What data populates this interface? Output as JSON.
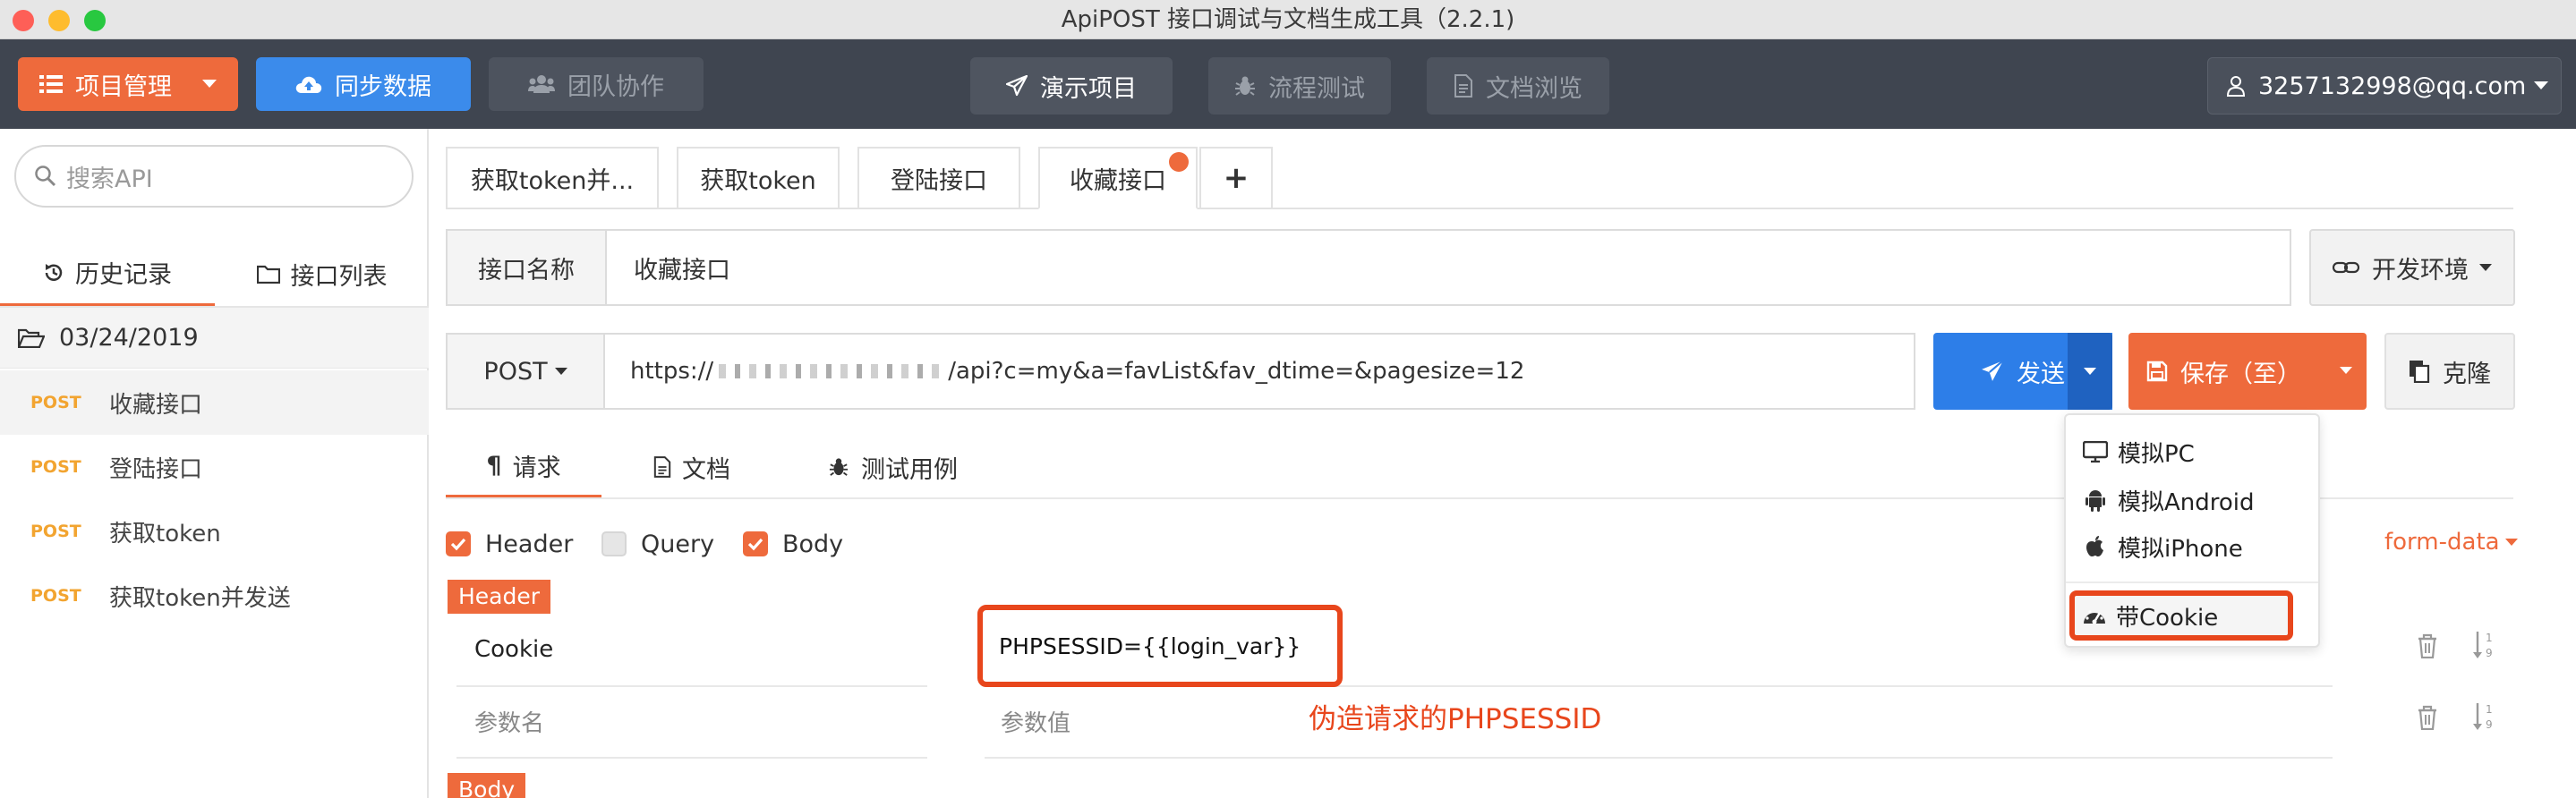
{
  "window": {
    "title": "ApiPOST 接口调试与文档生成工具（2.2.1)"
  },
  "toolbar": {
    "project_menu": "项目管理",
    "sync": "同步数据",
    "team": "团队协作",
    "demo": "演示项目",
    "flow_test": "流程测试",
    "doc_browse": "文档浏览",
    "account": "3257132998@qq.com"
  },
  "sidebar": {
    "search_placeholder": "搜索API",
    "tab_history": "历史记录",
    "tab_list": "接口列表",
    "date": "03/24/2019",
    "items": [
      {
        "method": "POST",
        "name": "收藏接口"
      },
      {
        "method": "POST",
        "name": "登陆接口"
      },
      {
        "method": "POST",
        "name": "获取token"
      },
      {
        "method": "POST",
        "name": "获取token并发送"
      }
    ]
  },
  "tabs": [
    "获取token并...",
    "获取token",
    "登陆接口",
    "收藏接口"
  ],
  "tab_add": "+",
  "form": {
    "name_label": "接口名称",
    "name_value": "收藏接口",
    "env": "开发环境",
    "method": "POST",
    "url_prefix": "https://",
    "url_path": "/api?c=my&a=favList&fav_dtime=&pagesize=12",
    "send": "发送",
    "save": "保存（至）",
    "clone": "克隆"
  },
  "subtabs": [
    "请求",
    "文档",
    "测试用例"
  ],
  "checks": [
    {
      "label": "Header",
      "checked": true
    },
    {
      "label": "Query",
      "checked": false
    },
    {
      "label": "Body",
      "checked": true
    }
  ],
  "body_type": "form-data",
  "sections": {
    "header": "Header",
    "body": "Body"
  },
  "header_rows": [
    {
      "key": "Cookie",
      "value": "PHPSESSID={{login_var}}"
    },
    {
      "key": "参数名",
      "value": "参数值"
    }
  ],
  "annotation": "伪造请求的PHPSESSID",
  "dropdown": {
    "items": [
      "模拟PC",
      "模拟Android",
      "模拟iPhone",
      "带Cookie"
    ]
  },
  "colors": {
    "toolbar_bg": "#3f4550",
    "accent_orange": "#ee6a3c",
    "send_blue": "#2d7ee8",
    "sync_blue": "#3b8beb",
    "annotation_red": "#e8461c"
  }
}
